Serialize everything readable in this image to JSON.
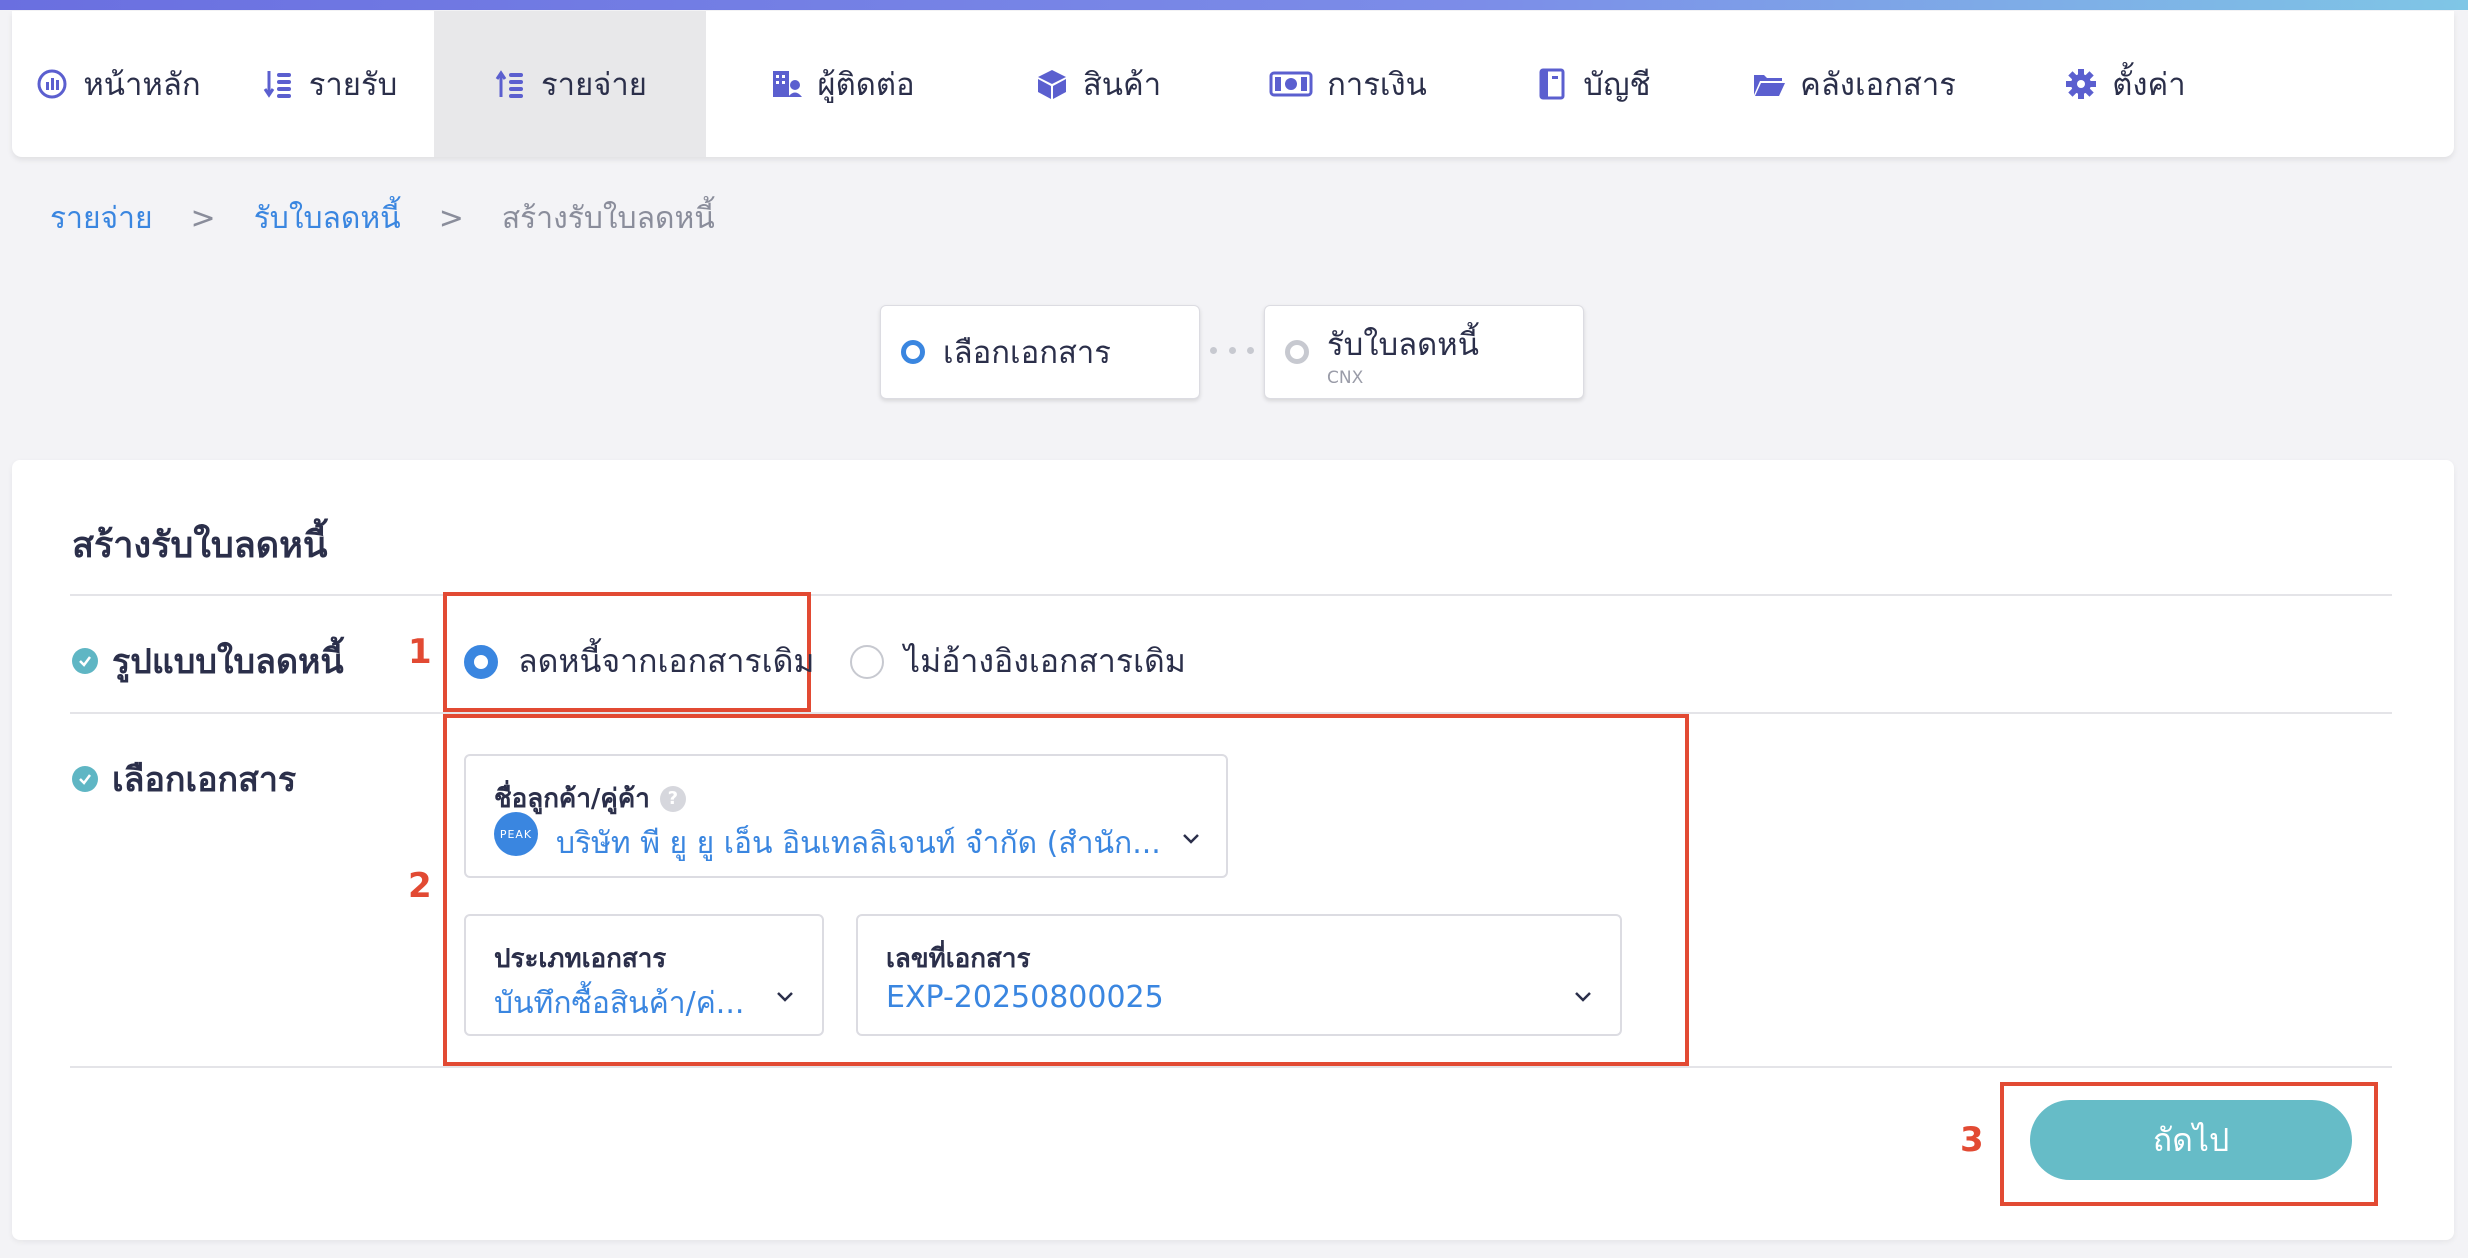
{
  "nav": {
    "items": [
      {
        "label": "หน้าหลัก",
        "icon": "dashboard-icon"
      },
      {
        "label": "รายรับ",
        "icon": "income-icon"
      },
      {
        "label": "รายจ่าย",
        "icon": "expense-icon"
      },
      {
        "label": "ผู้ติดต่อ",
        "icon": "contacts-icon"
      },
      {
        "label": "สินค้า",
        "icon": "box-icon"
      },
      {
        "label": "การเงิน",
        "icon": "money-icon"
      },
      {
        "label": "บัญชี",
        "icon": "ledger-icon"
      },
      {
        "label": "คลังเอกสาร",
        "icon": "folder-icon"
      },
      {
        "label": "ตั้งค่า",
        "icon": "gear-icon"
      }
    ],
    "active_index": 2
  },
  "breadcrumb": {
    "level1": "รายจ่าย",
    "level2": "รับใบลดหนี้",
    "current": "สร้างรับใบลดหนี้",
    "separator": ">"
  },
  "steps": [
    {
      "label": "เลือกเอกสาร",
      "sub": "",
      "active": true
    },
    {
      "label": "รับใบลดหนี้",
      "sub": "CNX",
      "active": false
    }
  ],
  "form": {
    "title": "สร้างรับใบลดหนี้",
    "format_label": "รูปแบบใบลดหนี้",
    "format_options": [
      {
        "label": "ลดหนี้จากเอกสารเดิม",
        "selected": true
      },
      {
        "label": "ไม่อ้างอิงเอกสารเดิม",
        "selected": false
      }
    ],
    "select_doc_label": "เลือกเอกสาร",
    "customer_field": {
      "label": "ชื่อลูกค้า/คู่ค้า",
      "help": "?",
      "logo_text": "PEAK",
      "value": "บริษัท พี ยู ยู เอ็น อินเทลลิเจนท์ จำกัด (สำนัก..."
    },
    "doc_type_field": {
      "label": "ประเภทเอกสาร",
      "value": "บันทึกซื้อสินค้า/ค่..."
    },
    "doc_no_field": {
      "label": "เลขที่เอกสาร",
      "value": "EXP-20250800025"
    },
    "next_button": "ถัดไป"
  },
  "annotations": [
    "1",
    "2",
    "3"
  ],
  "colors": {
    "accent": "#3a86e0",
    "button": "#66bcc7",
    "annotation": "#e24a33",
    "check": "#5fb6c4"
  }
}
